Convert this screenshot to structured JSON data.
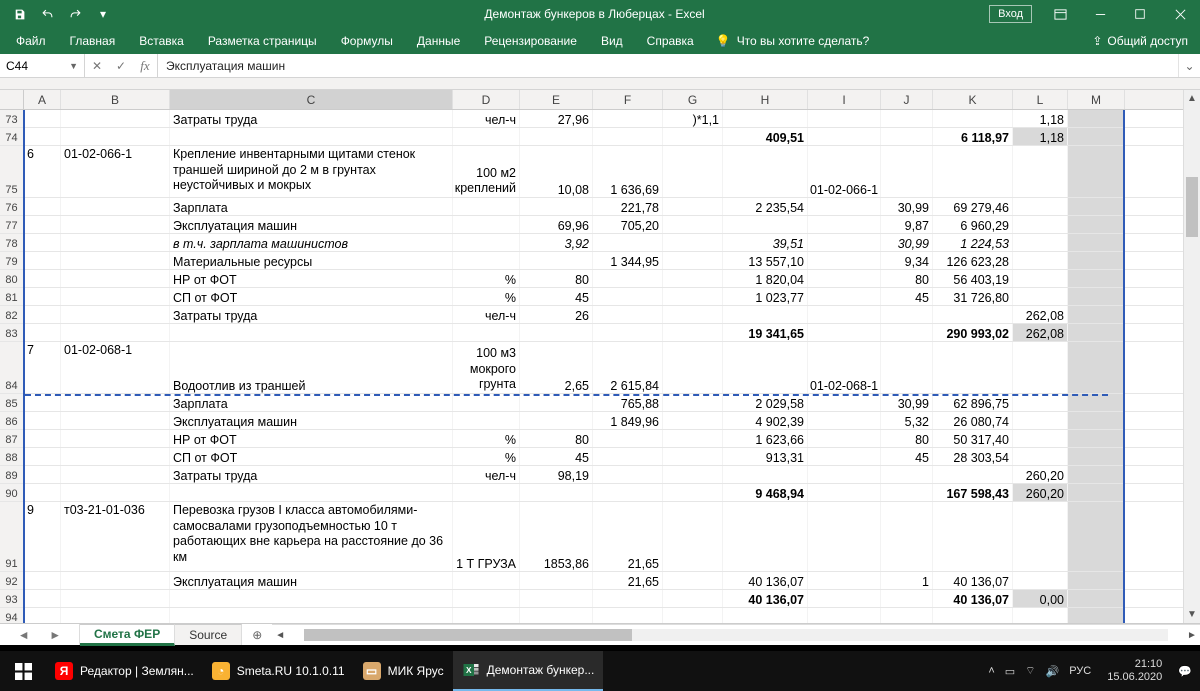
{
  "app": {
    "title": "Демонтаж бункеров в Люберцах  -  Excel",
    "login": "Вход"
  },
  "ribbon": {
    "tabs": [
      "Файл",
      "Главная",
      "Вставка",
      "Разметка страницы",
      "Формулы",
      "Данные",
      "Рецензирование",
      "Вид",
      "Справка"
    ],
    "tell": "Что вы хотите сделать?",
    "share": "Общий доступ"
  },
  "namebox": "C44",
  "formula": "Эксплуатация машин",
  "cols": [
    "A",
    "B",
    "C",
    "D",
    "E",
    "F",
    "G",
    "H",
    "I",
    "J",
    "K",
    "L",
    "M"
  ],
  "rows": [
    {
      "n": 73,
      "h": "h1",
      "C": "Затраты труда",
      "D": "чел-ч",
      "E": "27,96",
      "G": ")*1,1",
      "L": "1,18"
    },
    {
      "n": 74,
      "h": "h1",
      "H": "409,51",
      "Hb": true,
      "K": "6 118,97",
      "Kb": true,
      "L": "1,18",
      "Lg": true
    },
    {
      "n": 75,
      "h": "h3",
      "A": "6",
      "B": "01-02-066-1",
      "C": "Крепление инвентарными щитами стенок траншей шириной до 2 м в грунтах неустойчивых и мокрых",
      "Cwrap": true,
      "D": "100 м2 креплений",
      "Dwrap": true,
      "E": "10,08",
      "F": "1 636,69",
      "I": "01-02-066-1"
    },
    {
      "n": 76,
      "h": "h1",
      "C": "Зарплата",
      "F": "221,78",
      "H": "2 235,54",
      "J": "30,99",
      "K": "69 279,46"
    },
    {
      "n": 77,
      "h": "h1",
      "C": "Эксплуатация машин",
      "E": "69,96",
      "F": "705,20",
      "J": "9,87",
      "K": "6 960,29"
    },
    {
      "n": 78,
      "h": "h1",
      "C": "в т.ч. зарплата машинистов",
      "Ci": true,
      "E": "3,92",
      "Ei": true,
      "H": "39,51",
      "Hi": true,
      "J": "30,99",
      "Ji": true,
      "K": "1 224,53",
      "Ki": true
    },
    {
      "n": 79,
      "h": "h1",
      "C": "Материальные ресурсы",
      "F": "1 344,95",
      "H": "13 557,10",
      "J": "9,34",
      "K": "126 623,28"
    },
    {
      "n": 80,
      "h": "h1",
      "C": "НР от ФОТ",
      "D": "%",
      "E": "80",
      "H": "1 820,04",
      "J": "80",
      "K": "56 403,19"
    },
    {
      "n": 81,
      "h": "h1",
      "C": "СП от ФОТ",
      "D": "%",
      "E": "45",
      "H": "1 023,77",
      "J": "45",
      "K": "31 726,80"
    },
    {
      "n": 82,
      "h": "h1",
      "C": "Затраты труда",
      "D": "чел-ч",
      "E": "26",
      "L": "262,08"
    },
    {
      "n": 83,
      "h": "h1",
      "H": "19 341,65",
      "Hb": true,
      "K": "290 993,02",
      "Kb": true,
      "L": "262,08",
      "Lg": true
    },
    {
      "n": 84,
      "h": "h3",
      "A": "7",
      "B": "01-02-068-1",
      "C": "Водоотлив из траншей",
      "D": "100 м3 мокрого грунта",
      "Dwrap": true,
      "E": "2,65",
      "F": "2 615,84",
      "I": "01-02-068-1"
    },
    {
      "n": 85,
      "h": "h1",
      "C": "Зарплата",
      "F": "765,88",
      "H": "2 029,58",
      "J": "30,99",
      "K": "62 896,75"
    },
    {
      "n": 86,
      "h": "h1",
      "C": "Эксплуатация машин",
      "F": "1 849,96",
      "H": "4 902,39",
      "J": "5,32",
      "K": "26 080,74"
    },
    {
      "n": 87,
      "h": "h1",
      "C": "НР от ФОТ",
      "D": "%",
      "E": "80",
      "H": "1 623,66",
      "J": "80",
      "K": "50 317,40"
    },
    {
      "n": 88,
      "h": "h1",
      "C": "СП от ФОТ",
      "D": "%",
      "E": "45",
      "H": "913,31",
      "J": "45",
      "K": "28 303,54"
    },
    {
      "n": 89,
      "h": "h1",
      "C": "Затраты труда",
      "D": "чел-ч",
      "E": "98,19",
      "L": "260,20"
    },
    {
      "n": 90,
      "h": "h1",
      "H": "9 468,94",
      "Hb": true,
      "K": "167 598,43",
      "Kb": true,
      "L": "260,20",
      "Lg": true
    },
    {
      "n": 91,
      "h": "h4",
      "A": "9",
      "B": "т03-21-01-036",
      "C": "Перевозка грузов I класса автомобилями-самосвалами грузоподъемностью 10 т работающих вне карьера на расстояние до 36 км",
      "Cwrap": true,
      "D": "1 Т ГРУЗА",
      "E": "1853,86",
      "F": "21,65"
    },
    {
      "n": 92,
      "h": "h1",
      "C": "Эксплуатация машин",
      "F": "21,65",
      "H": "40 136,07",
      "J": "1",
      "K": "40 136,07"
    },
    {
      "n": 93,
      "h": "h1",
      "H": "40 136,07",
      "Hb": true,
      "K": "40 136,07",
      "Kb": true,
      "L": "0,00",
      "Lg": true
    },
    {
      "n": 94,
      "h": "h1"
    }
  ],
  "sheets": {
    "active": "Смета ФЕР",
    "other": "Source"
  },
  "taskbar": {
    "items": [
      {
        "label": "Редактор | Землян...",
        "icon": "Я",
        "bg": "#ff0000"
      },
      {
        "label": "Smeta.RU  10.1.0.11",
        "icon": "◔",
        "bg": "#f9b233"
      },
      {
        "label": "МИК Ярус",
        "icon": "▭",
        "bg": "#d9a86c"
      },
      {
        "label": "Демонтаж бункер...",
        "icon": "X",
        "bg": "#217346",
        "xl": true,
        "active": true
      }
    ],
    "lang": "РУС",
    "time": "21:10",
    "date": "15.06.2020"
  }
}
